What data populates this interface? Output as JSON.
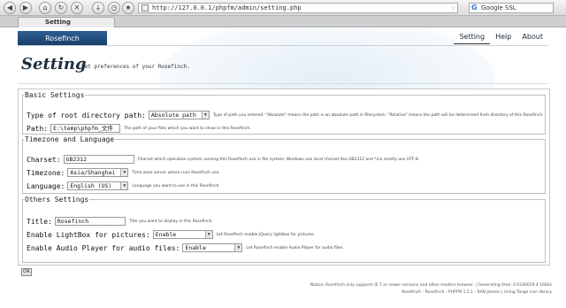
{
  "browser": {
    "url": "http://127.0.0.1/phpfm/admin/setting.php",
    "search_placeholder": "Google SSL",
    "tab_title": "Setting",
    "search_engine_icon": "G",
    "nav_icons": [
      "back-icon",
      "forward-icon",
      "reload-icon",
      "stop-icon",
      "home-icon",
      "downloads-icon",
      "history-icon",
      "bookmark-icon"
    ]
  },
  "header": {
    "brand": "Rosefinch",
    "nav": [
      {
        "label": "Setting",
        "active": true
      },
      {
        "label": "Help",
        "active": false
      },
      {
        "label": "About",
        "active": false
      }
    ]
  },
  "page": {
    "title": "Setting",
    "subtitle": "Set preferences of your Rosefinch."
  },
  "form": {
    "basic": {
      "legend": "Basic Settings",
      "root_type": {
        "label": "Type of root directory path:",
        "value": "Absolute path",
        "hint": "Type of path you entered. \"Absolute\" means the path is an absolute path in filesystem. \"Relative\" means the path will be determined from directory of this Rosefinch"
      },
      "path": {
        "label": "Path:",
        "value": "E:\\temp\\phpfm_文件",
        "hint": "The path of your files which you want to show in this Rosefinch."
      }
    },
    "timezone": {
      "legend": "Timezone and Language",
      "charset": {
        "label": "Charset:",
        "value": "GB2312",
        "hint": "Charset which operation system running this Rosefinch use in file system. Windows use local charset like GB2312 and *nix mostly use UTF-8."
      },
      "tz": {
        "label": "Timezone:",
        "value": "Asia/Shanghai",
        "hint": "Time zone server where runs Rosefinch use."
      },
      "language": {
        "label": "Language:",
        "value": "English (US)",
        "hint": "Language you want to use in this Rosefinch."
      }
    },
    "others": {
      "legend": "Others Settings",
      "title": {
        "label": "Title:",
        "value": "Rosefinch",
        "hint": "Title you want to display in this Rosefinch."
      },
      "lightbox": {
        "label": "Enable LightBox for pictures:",
        "value": "Enable",
        "hint": "Let Rosefinch enable jQuery lightbox for pictures."
      },
      "audio": {
        "label": "Enable Audio Player for audio files:",
        "value": "Enable",
        "hint": "Let Rosefinch enable Audio Player for audio files."
      }
    },
    "ok_label": "OK"
  },
  "footer": {
    "line1": "Notice: Rosefinch only supports IE 7 or newer versions and other modern browser. | Generating time: 0.0330019 4 1660s",
    "line2": "Rosefinch - Rosefinch - PHPFM 1.2.1 - RAN Jiamen | Using Tango icon library"
  }
}
